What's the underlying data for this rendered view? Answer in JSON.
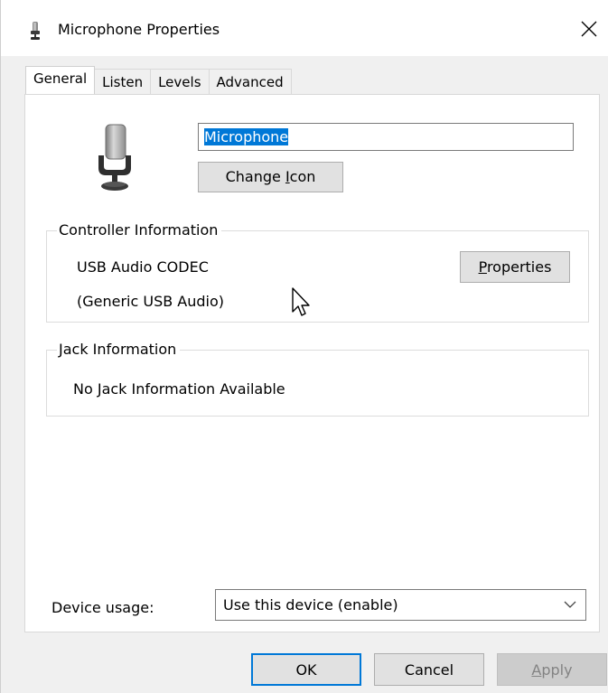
{
  "window": {
    "title": "Microphone Properties",
    "close_label": "✕"
  },
  "tabs": [
    {
      "label": "General",
      "active": true
    },
    {
      "label": "Listen",
      "active": false
    },
    {
      "label": "Levels",
      "active": false
    },
    {
      "label": "Advanced",
      "active": false
    }
  ],
  "general": {
    "device_name": "Microphone",
    "change_icon_label_pre": "Change ",
    "change_icon_label_accel": "I",
    "change_icon_label_post": "con",
    "controller_info": {
      "legend": "Controller Information",
      "line1": "USB Audio CODEC",
      "line2": "(Generic USB Audio)",
      "properties_accel": "P",
      "properties_post": "roperties"
    },
    "jack_info": {
      "legend": "Jack Information",
      "text": "No Jack Information Available"
    },
    "device_usage": {
      "label": "Device usage:",
      "selected": "Use this device (enable)"
    }
  },
  "footer": {
    "ok": "OK",
    "cancel": "Cancel",
    "apply_accel": "A",
    "apply_post": "pply"
  },
  "colors": {
    "selection": "#0078d7",
    "window_bg": "#f0f0f0",
    "panel_bg": "#ffffff",
    "button_bg": "#e1e1e1",
    "disabled_text": "#838383"
  },
  "icons": {
    "title": "microphone-icon",
    "device": "microphone-icon",
    "close": "close-icon",
    "dropdown": "chevron-down-icon",
    "pointer": "mouse-pointer-icon"
  }
}
